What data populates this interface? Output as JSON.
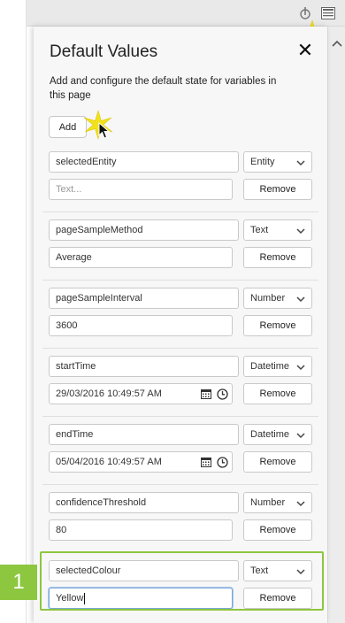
{
  "panel": {
    "title": "Default Values",
    "description": "Add and configure the default state for variables in this page",
    "add_label": "Add",
    "close_icon": "close-icon"
  },
  "icons": {
    "top_left": "mouse-pointer-icon",
    "top_right": "list-panel-icon",
    "calendar": "calendar-icon",
    "clock": "clock-icon",
    "chevron": "chevron-down-icon",
    "scroll_up": "chevron-up-icon"
  },
  "colors": {
    "highlight": "#8dc63f",
    "panel_bg": "#f7f7f7",
    "focus": "#7aa7d8"
  },
  "variables": [
    {
      "name": "selectedEntity",
      "type": "Entity",
      "value": "",
      "placeholder": "Text...",
      "remove": "Remove"
    },
    {
      "name": "pageSampleMethod",
      "type": "Text",
      "value": "Average",
      "remove": "Remove"
    },
    {
      "name": "pageSampleInterval",
      "type": "Number",
      "value": "3600",
      "remove": "Remove"
    },
    {
      "name": "startTime",
      "type": "Datetime",
      "value": "29/03/2016 10:49:57 AM",
      "remove": "Remove"
    },
    {
      "name": "endTime",
      "type": "Datetime",
      "value": "05/04/2016 10:49:57 AM",
      "remove": "Remove"
    },
    {
      "name": "confidenceThreshold",
      "type": "Number",
      "value": "80",
      "remove": "Remove"
    },
    {
      "name": "selectedColour",
      "type": "Text",
      "value": "Yellow",
      "remove": "Remove"
    }
  ],
  "step_badge": "1"
}
